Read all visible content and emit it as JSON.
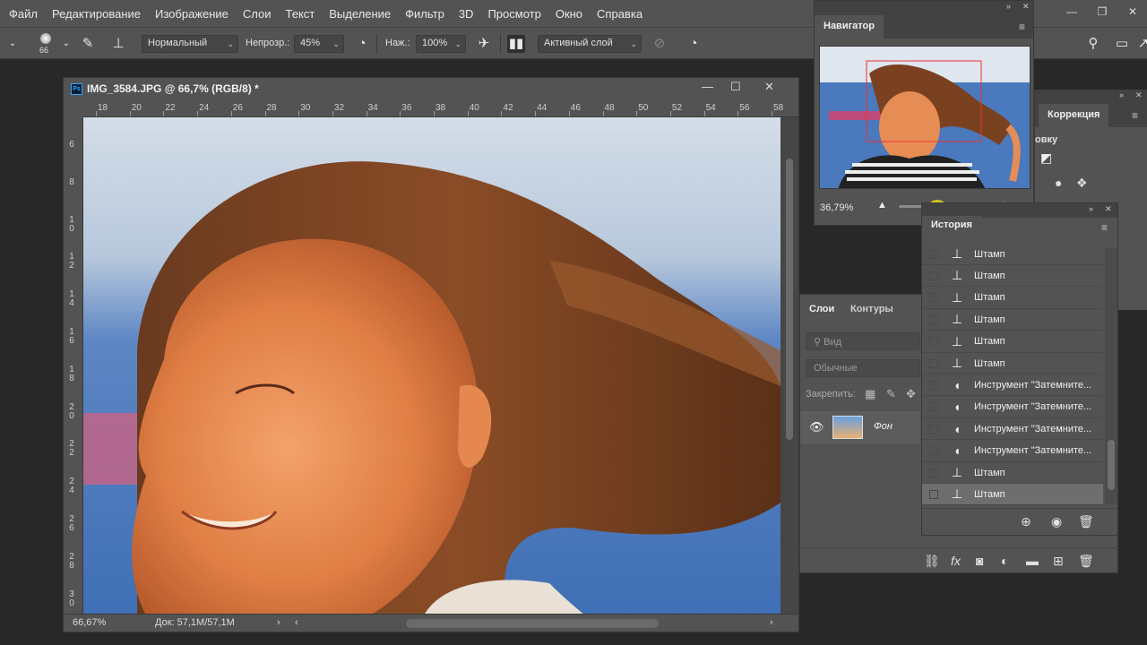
{
  "menu": {
    "items": [
      "Файл",
      "Редактирование",
      "Изображение",
      "Слои",
      "Текст",
      "Выделение",
      "Фильтр",
      "3D",
      "Просмотр",
      "Окно",
      "Справка"
    ],
    "window_controls": [
      "minimize",
      "restore",
      "close"
    ]
  },
  "options": {
    "brush_size": "66",
    "blend_mode": "Нормальный",
    "opacity_label": "Непрозр.:",
    "opacity_value": "45%",
    "flow_label": "Наж.:",
    "flow_value": "100%",
    "sample": "Активный слой"
  },
  "document": {
    "title": "IMG_3584.JPG @ 66,7% (RGB/8) *",
    "ruler_top": [
      "18",
      "20",
      "22",
      "24",
      "26",
      "28",
      "30",
      "32",
      "34",
      "36",
      "38",
      "40",
      "42",
      "44",
      "46",
      "48",
      "50",
      "52",
      "54",
      "56",
      "58"
    ],
    "ruler_left": [
      "6",
      "8",
      "10",
      "12",
      "14",
      "16",
      "18",
      "20",
      "22",
      "24",
      "26",
      "28",
      "30",
      "32"
    ],
    "zoom": "66,67%",
    "doc_info": "Док: 57,1M/57,1M"
  },
  "navigator": {
    "tab": "Навигатор",
    "zoom": "36,79%",
    "zoom_level": 0.43
  },
  "correction": {
    "tab": "Коррекция",
    "partial_label": "овку"
  },
  "history": {
    "tab": "История",
    "items": [
      {
        "label": "Штамп",
        "icon": "stamp-icon"
      },
      {
        "label": "Штамп",
        "icon": "stamp-icon"
      },
      {
        "label": "Штамп",
        "icon": "stamp-icon"
      },
      {
        "label": "Штамп",
        "icon": "stamp-icon"
      },
      {
        "label": "Штамп",
        "icon": "stamp-icon"
      },
      {
        "label": "Штамп",
        "icon": "stamp-icon"
      },
      {
        "label": "Инструмент \"Затемните...",
        "icon": "burn-icon"
      },
      {
        "label": "Инструмент \"Затемните...",
        "icon": "burn-icon"
      },
      {
        "label": "Инструмент \"Затемните...",
        "icon": "burn-icon"
      },
      {
        "label": "Инструмент \"Затемните...",
        "icon": "burn-icon"
      },
      {
        "label": "Штамп",
        "icon": "stamp-icon"
      },
      {
        "label": "Штамп",
        "icon": "stamp-icon"
      }
    ],
    "selected_index": 11
  },
  "layers": {
    "tabs": [
      "Слои",
      "Контуры"
    ],
    "search_placeholder": "Вид",
    "blend_mode": "Обычные",
    "lock_label": "Закрепить:",
    "layer_name": "Фон"
  },
  "colors": {
    "panel_bg": "#535353",
    "app_bg": "#282828",
    "accent_knob": "#e1dc1e",
    "ps_blue": "#31a8ff"
  }
}
